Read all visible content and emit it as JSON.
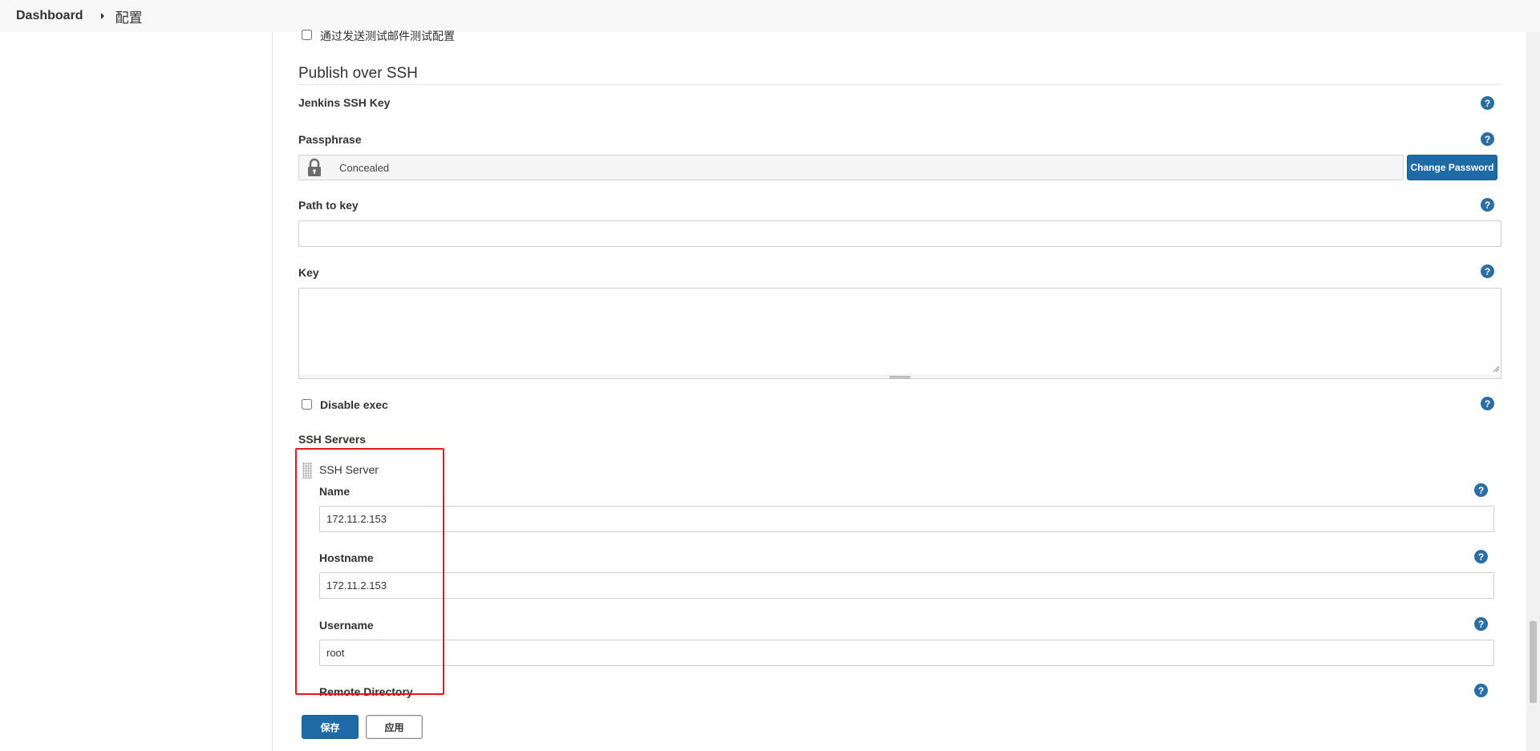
{
  "breadcrumb": {
    "home": "Dashboard",
    "current": "配置"
  },
  "email_test": {
    "label": "通过发送测试邮件测试配置",
    "checked": false
  },
  "section": {
    "title": "Publish over SSH"
  },
  "fields": {
    "jenkins_ssh_key": "Jenkins SSH Key",
    "passphrase": {
      "label": "Passphrase",
      "concealed_text": "Concealed",
      "change_button": "Change Password"
    },
    "path_to_key": {
      "label": "Path to key",
      "value": ""
    },
    "key": {
      "label": "Key",
      "value": ""
    },
    "disable_exec": {
      "label": "Disable exec",
      "checked": false
    },
    "ssh_servers": "SSH Servers"
  },
  "ssh_server": {
    "title": "SSH Server",
    "name": {
      "label": "Name",
      "value": "172.11.2.153"
    },
    "hostname": {
      "label": "Hostname",
      "value": "172.11.2.153"
    },
    "username": {
      "label": "Username",
      "value": "root"
    },
    "remote_directory": {
      "label": "Remote Directory"
    }
  },
  "buttons": {
    "save": "保存",
    "apply": "应用"
  },
  "help_symbol": "?",
  "colors": {
    "primary": "#1e6aa5",
    "help": "#2a6ea6",
    "highlight": "#e01a1a"
  }
}
